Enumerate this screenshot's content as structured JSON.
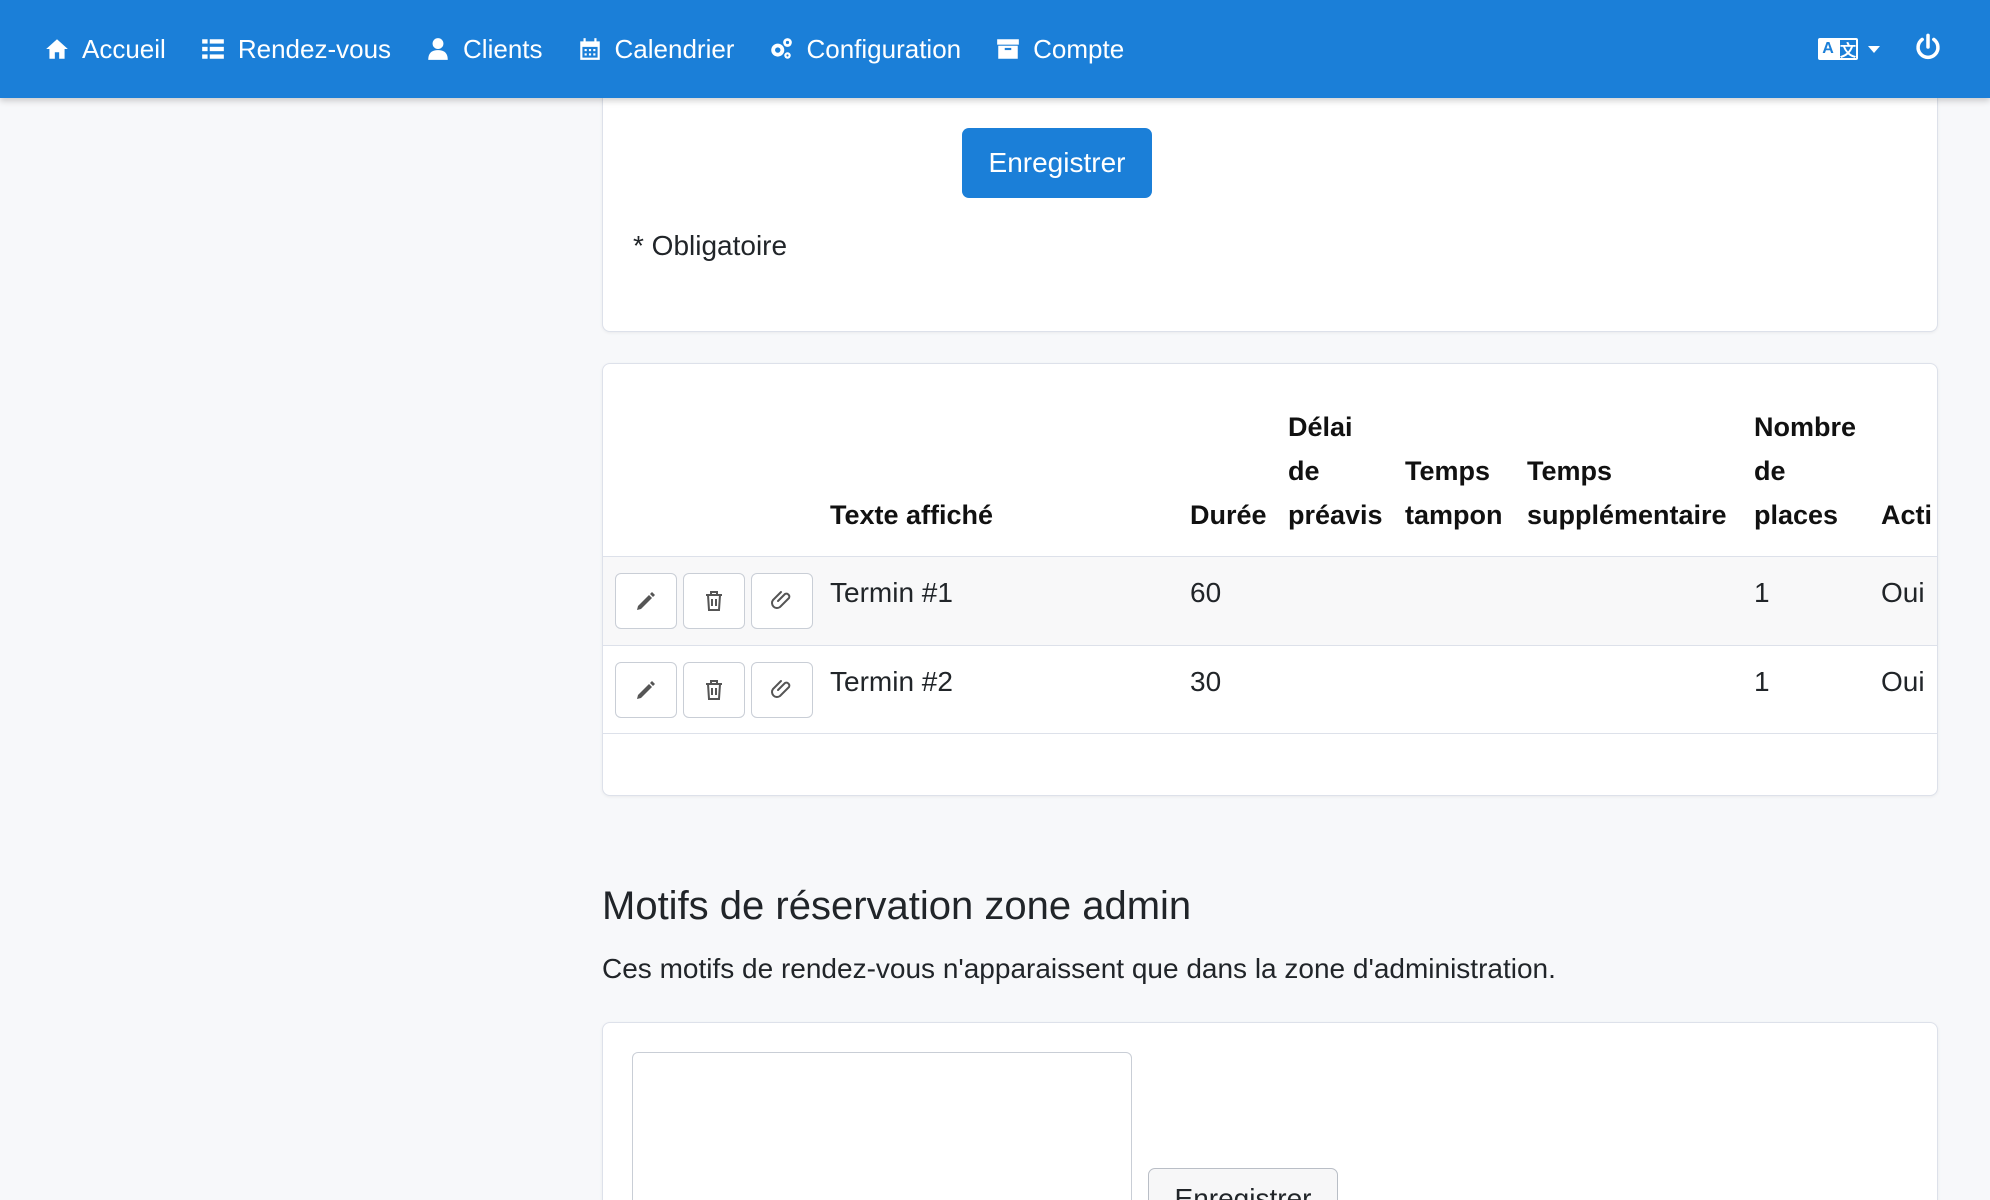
{
  "nav": {
    "items": [
      {
        "label": "Accueil",
        "icon": "home-icon"
      },
      {
        "label": "Rendez-vous",
        "icon": "list-icon"
      },
      {
        "label": "Clients",
        "icon": "user-icon"
      },
      {
        "label": "Calendrier",
        "icon": "calendar-icon"
      },
      {
        "label": "Configuration",
        "icon": "gears-icon"
      },
      {
        "label": "Compte",
        "icon": "archive-icon"
      }
    ],
    "language_icon": "translate-icon",
    "power_icon": "power-icon"
  },
  "form_top": {
    "save_label": "Enregistrer",
    "required_note": "* Obligatoire"
  },
  "table": {
    "headers": {
      "label": "Texte affiché",
      "duration": "Durée",
      "notice_l1": "Délai",
      "notice_l2": "de",
      "notice_l3": "préavis",
      "buffer_l1": "Temps",
      "buffer_l2": "tampon",
      "extra_l1": "Temps",
      "extra_l2": "supplémentaire",
      "places_l1": "Nombre",
      "places_l2": "de",
      "places_l3": "places",
      "active": "Acti"
    },
    "rows": [
      {
        "label": "Termin #1",
        "duration": "60",
        "notice": "",
        "buffer": "",
        "extra": "",
        "places": "1",
        "active": "Oui"
      },
      {
        "label": "Termin #2",
        "duration": "30",
        "notice": "",
        "buffer": "",
        "extra": "",
        "places": "1",
        "active": "Oui"
      }
    ],
    "row_action_icons": [
      "pencil-icon",
      "trash-icon",
      "paperclip-icon"
    ]
  },
  "admin_section": {
    "title": "Motifs de réservation zone admin",
    "description": "Ces motifs de rendez-vous n'apparaissent que dans la zone d'administration.",
    "save_label": "Enregistrer"
  },
  "colors": {
    "primary": "#1b7fd8",
    "background": "#f7f8fa"
  }
}
